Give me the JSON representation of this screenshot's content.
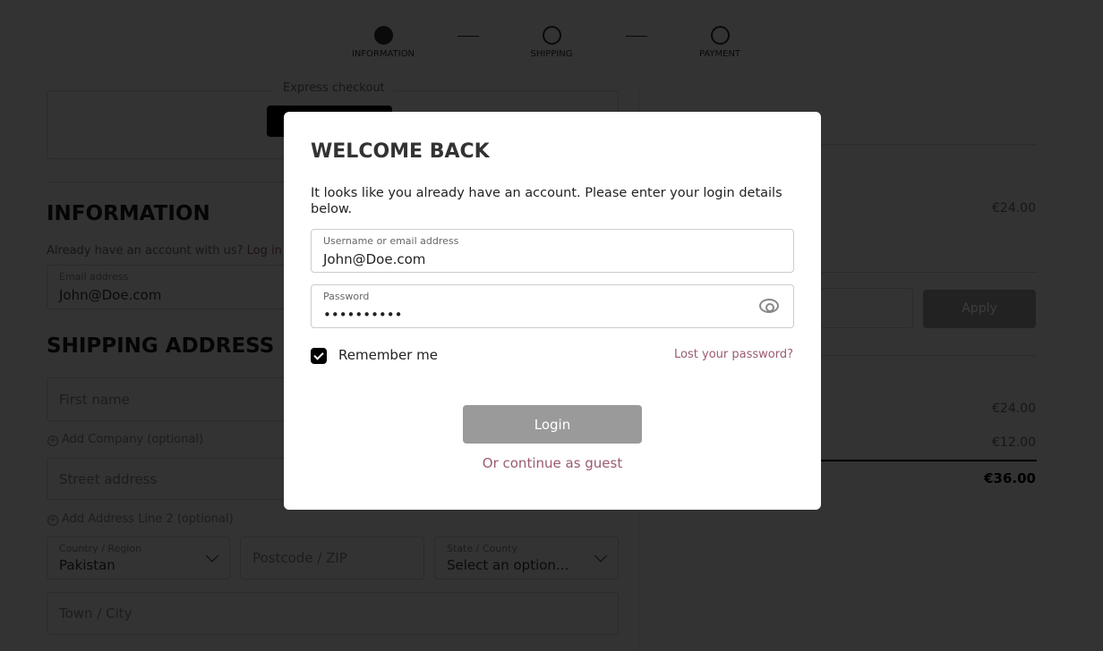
{
  "steps": [
    {
      "label": "INFORMATION",
      "active": true
    },
    {
      "label": "SHIPPING",
      "active": false
    },
    {
      "label": "PAYMENT",
      "active": false
    }
  ],
  "express": {
    "legend": "Express checkout"
  },
  "information": {
    "heading": "INFORMATION",
    "account_prompt": "Already have an account with us?",
    "login_link": "Log in",
    "email_label": "Email address",
    "email_value": "John@Doe.com"
  },
  "shipping": {
    "heading": "SHIPPING ADDRESS",
    "first_name_placeholder": "First name",
    "add_company": "Add Company (optional)",
    "street_placeholder": "Street address",
    "add_line2": "Add Address Line 2 (optional)",
    "country_label": "Country / Region",
    "country_value": "Pakistan",
    "postcode_placeholder": "Postcode / ZIP",
    "state_label": "State / County",
    "state_value": "Select an option...",
    "town_placeholder": "Town / City"
  },
  "summary": {
    "item_price": "€24.00",
    "apply_label": "Apply",
    "subtotal": "€24.00",
    "shipping": "€12.00",
    "total": "€36.00"
  },
  "modal": {
    "title": "WELCOME BACK",
    "intro": "It looks like you already have an account. Please enter your login details below.",
    "username_label": "Username or email address",
    "username_value": "John@Doe.com",
    "password_label": "Password",
    "password_value": "••••••••••",
    "remember_label": "Remember me",
    "remember_checked": true,
    "lost_password": "Lost your password?",
    "login_label": "Login",
    "guest_label": "Or continue as guest",
    "link_color": "#9b5a72"
  }
}
